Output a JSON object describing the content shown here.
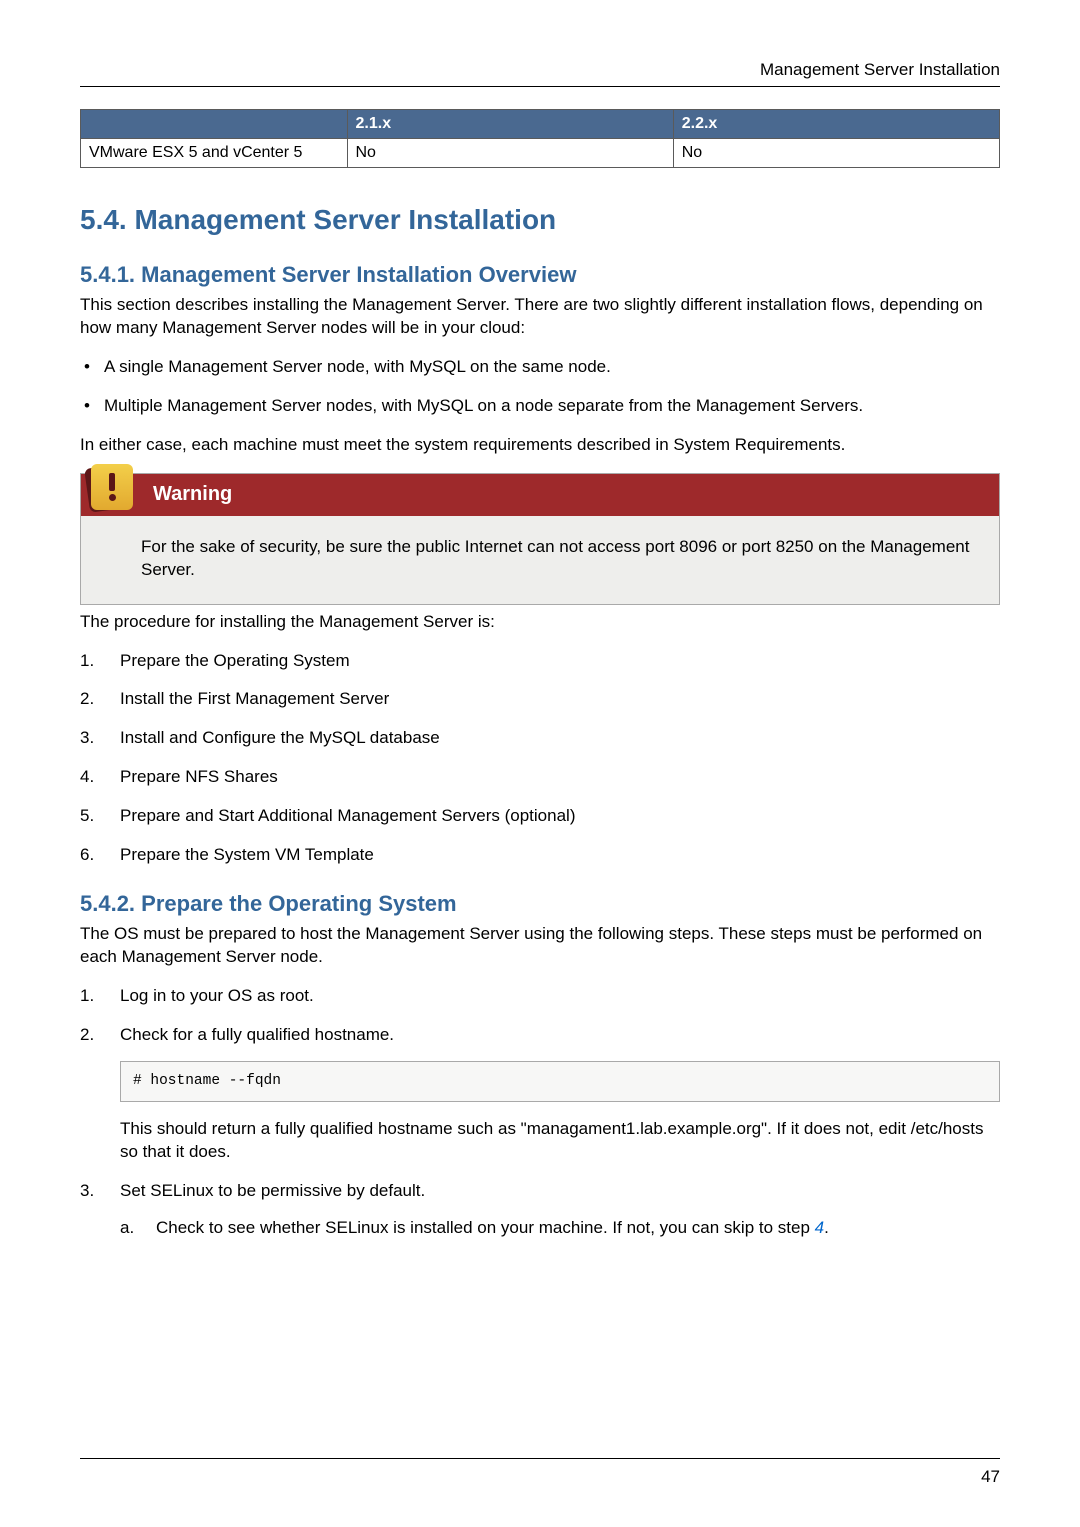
{
  "running_head": "Management Server Installation",
  "compat_table": {
    "headers": [
      "",
      "2.1.x",
      "2.2.x"
    ],
    "row": {
      "label": "VMware ESX 5 and vCenter 5",
      "v21": "No",
      "v22": "No"
    }
  },
  "h1": "5.4. Management Server Installation",
  "s541": {
    "heading": "5.4.1. Management Server Installation Overview",
    "intro": "This section describes installing the Management Server. There are two slightly different installation flows, depending on how many Management Server nodes will be in your cloud:",
    "bullets": [
      "A single Management Server node, with MySQL on the same node.",
      "Multiple Management Server nodes, with MySQL on a node separate from the Management Servers."
    ],
    "either_case": "In either case, each machine must meet the system requirements described in System Requirements.",
    "warning_title": "Warning",
    "warning_body": "For the sake of security, be sure the public Internet can not access port 8096 or port 8250 on the Management Server.",
    "after_box": "The procedure for installing the Management Server is:",
    "steps": [
      "Prepare the Operating System",
      "Install the First Management Server",
      "Install and Configure the MySQL database",
      "Prepare NFS Shares",
      "Prepare and Start Additional Management Servers (optional)",
      "Prepare the System VM Template"
    ]
  },
  "s542": {
    "heading": "5.4.2. Prepare the Operating System",
    "intro": "The OS must be prepared to host the Management Server using the following steps. These steps must be performed on each Management Server node.",
    "step1": "Log in to your OS as root.",
    "step2": "Check for a fully qualified hostname.",
    "code": "# hostname --fqdn",
    "step2_after": "This should return a fully qualified hostname such as \"managament1.lab.example.org\". If it does not, edit /etc/hosts so that it does.",
    "step3": "Set SELinux to be permissive by default.",
    "step3a_prefix": "Check to see whether SELinux is installed on your machine. If not, you can skip to step ",
    "step3a_link": "4",
    "step3a_suffix": "."
  },
  "page_number": "47"
}
